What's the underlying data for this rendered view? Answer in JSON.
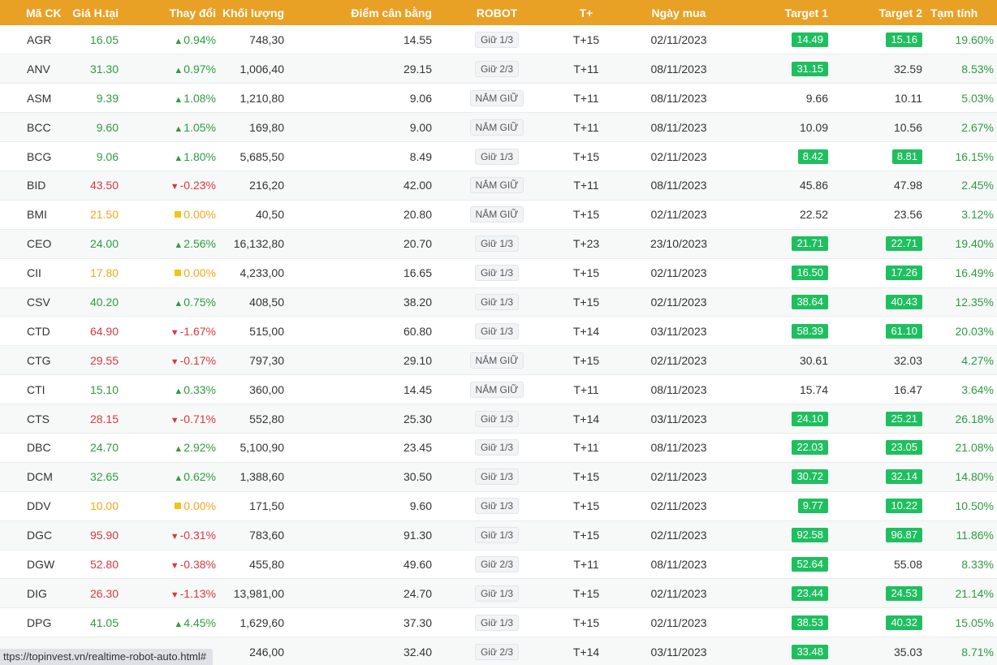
{
  "header": {
    "symbol": "Mã CK",
    "price": "Giá H.tại",
    "change": "Thay đổi",
    "volume": "Khối lượng",
    "balance": "Điểm cân bằng",
    "robot": "ROBOT",
    "tplus": "T+",
    "buy_date": "Ngày mua",
    "target1": "Target 1",
    "target2": "Target 2",
    "temp": "Tạm tính"
  },
  "rows": [
    {
      "symbol": "AGR",
      "price": "16.05",
      "trend": "up",
      "change": "0.94%",
      "volume": "748,30",
      "balance": "14.55",
      "robot": "Giữ 1/3",
      "tplus": "T+15",
      "buy_date": "02/11/2023",
      "target1": "14.49",
      "t1_hit": true,
      "target2": "15.16",
      "t2_hit": true,
      "temp": "19.60%"
    },
    {
      "symbol": "ANV",
      "price": "31.30",
      "trend": "up",
      "change": "0.97%",
      "volume": "1,006,40",
      "balance": "29.15",
      "robot": "Giữ 2/3",
      "tplus": "T+11",
      "buy_date": "08/11/2023",
      "target1": "31.15",
      "t1_hit": true,
      "target2": "32.59",
      "t2_hit": false,
      "temp": "8.53%"
    },
    {
      "symbol": "ASM",
      "price": "9.39",
      "trend": "up",
      "change": "1.08%",
      "volume": "1,210,80",
      "balance": "9.06",
      "robot": "NẮM GIỮ",
      "tplus": "T+11",
      "buy_date": "08/11/2023",
      "target1": "9.66",
      "t1_hit": false,
      "target2": "10.11",
      "t2_hit": false,
      "temp": "5.03%"
    },
    {
      "symbol": "BCC",
      "price": "9.60",
      "trend": "up",
      "change": "1.05%",
      "volume": "169,80",
      "balance": "9.00",
      "robot": "NẮM GIỮ",
      "tplus": "T+11",
      "buy_date": "08/11/2023",
      "target1": "10.09",
      "t1_hit": false,
      "target2": "10.56",
      "t2_hit": false,
      "temp": "2.67%"
    },
    {
      "symbol": "BCG",
      "price": "9.06",
      "trend": "up",
      "change": "1.80%",
      "volume": "5,685,50",
      "balance": "8.49",
      "robot": "Giữ 1/3",
      "tplus": "T+15",
      "buy_date": "02/11/2023",
      "target1": "8.42",
      "t1_hit": true,
      "target2": "8.81",
      "t2_hit": true,
      "temp": "16.15%"
    },
    {
      "symbol": "BID",
      "price": "43.50",
      "trend": "down",
      "change": "-0.23%",
      "volume": "216,20",
      "balance": "42.00",
      "robot": "NẮM GIỮ",
      "tplus": "T+11",
      "buy_date": "08/11/2023",
      "target1": "45.86",
      "t1_hit": false,
      "target2": "47.98",
      "t2_hit": false,
      "temp": "2.45%"
    },
    {
      "symbol": "BMI",
      "price": "21.50",
      "trend": "ref",
      "change": "0.00%",
      "volume": "40,50",
      "balance": "20.80",
      "robot": "NẮM GIỮ",
      "tplus": "T+15",
      "buy_date": "02/11/2023",
      "target1": "22.52",
      "t1_hit": false,
      "target2": "23.56",
      "t2_hit": false,
      "temp": "3.12%"
    },
    {
      "symbol": "CEO",
      "price": "24.00",
      "trend": "up",
      "change": "2.56%",
      "volume": "16,132,80",
      "balance": "20.70",
      "robot": "Giữ 1/3",
      "tplus": "T+23",
      "buy_date": "23/10/2023",
      "target1": "21.71",
      "t1_hit": true,
      "target2": "22.71",
      "t2_hit": true,
      "temp": "19.40%"
    },
    {
      "symbol": "CII",
      "price": "17.80",
      "trend": "ref",
      "change": "0.00%",
      "volume": "4,233,00",
      "balance": "16.65",
      "robot": "Giữ 1/3",
      "tplus": "T+15",
      "buy_date": "02/11/2023",
      "target1": "16.50",
      "t1_hit": true,
      "target2": "17.26",
      "t2_hit": true,
      "temp": "16.49%"
    },
    {
      "symbol": "CSV",
      "price": "40.20",
      "trend": "up",
      "change": "0.75%",
      "volume": "408,50",
      "balance": "38.20",
      "robot": "Giữ 1/3",
      "tplus": "T+15",
      "buy_date": "02/11/2023",
      "target1": "38.64",
      "t1_hit": true,
      "target2": "40.43",
      "t2_hit": true,
      "temp": "12.35%"
    },
    {
      "symbol": "CTD",
      "price": "64.90",
      "trend": "down",
      "change": "-1.67%",
      "volume": "515,00",
      "balance": "60.80",
      "robot": "Giữ 1/3",
      "tplus": "T+14",
      "buy_date": "03/11/2023",
      "target1": "58.39",
      "t1_hit": true,
      "target2": "61.10",
      "t2_hit": true,
      "temp": "20.03%"
    },
    {
      "symbol": "CTG",
      "price": "29.55",
      "trend": "down",
      "change": "-0.17%",
      "volume": "797,30",
      "balance": "29.10",
      "robot": "NẮM GIỮ",
      "tplus": "T+15",
      "buy_date": "02/11/2023",
      "target1": "30.61",
      "t1_hit": false,
      "target2": "32.03",
      "t2_hit": false,
      "temp": "4.27%"
    },
    {
      "symbol": "CTI",
      "price": "15.10",
      "trend": "up",
      "change": "0.33%",
      "volume": "360,00",
      "balance": "14.45",
      "robot": "NẮM GIỮ",
      "tplus": "T+11",
      "buy_date": "08/11/2023",
      "target1": "15.74",
      "t1_hit": false,
      "target2": "16.47",
      "t2_hit": false,
      "temp": "3.64%"
    },
    {
      "symbol": "CTS",
      "price": "28.15",
      "trend": "down",
      "change": "-0.71%",
      "volume": "552,80",
      "balance": "25.30",
      "robot": "Giữ 1/3",
      "tplus": "T+14",
      "buy_date": "03/11/2023",
      "target1": "24.10",
      "t1_hit": true,
      "target2": "25.21",
      "t2_hit": true,
      "temp": "26.18%"
    },
    {
      "symbol": "DBC",
      "price": "24.70",
      "trend": "up",
      "change": "2.92%",
      "volume": "5,100,90",
      "balance": "23.45",
      "robot": "Giữ 1/3",
      "tplus": "T+11",
      "buy_date": "08/11/2023",
      "target1": "22.03",
      "t1_hit": true,
      "target2": "23.05",
      "t2_hit": true,
      "temp": "21.08%"
    },
    {
      "symbol": "DCM",
      "price": "32.65",
      "trend": "up",
      "change": "0.62%",
      "volume": "1,388,60",
      "balance": "30.50",
      "robot": "Giữ 1/3",
      "tplus": "T+15",
      "buy_date": "02/11/2023",
      "target1": "30.72",
      "t1_hit": true,
      "target2": "32.14",
      "t2_hit": true,
      "temp": "14.80%"
    },
    {
      "symbol": "DDV",
      "price": "10.00",
      "trend": "ref",
      "change": "0.00%",
      "volume": "171,50",
      "balance": "9.60",
      "robot": "Giữ 1/3",
      "tplus": "T+15",
      "buy_date": "02/11/2023",
      "target1": "9.77",
      "t1_hit": true,
      "target2": "10.22",
      "t2_hit": true,
      "temp": "10.50%"
    },
    {
      "symbol": "DGC",
      "price": "95.90",
      "trend": "down",
      "change": "-0.31%",
      "volume": "783,60",
      "balance": "91.30",
      "robot": "Giữ 1/3",
      "tplus": "T+15",
      "buy_date": "02/11/2023",
      "target1": "92.58",
      "t1_hit": true,
      "target2": "96.87",
      "t2_hit": true,
      "temp": "11.86%"
    },
    {
      "symbol": "DGW",
      "price": "52.80",
      "trend": "down",
      "change": "-0.38%",
      "volume": "455,80",
      "balance": "49.60",
      "robot": "Giữ 2/3",
      "tplus": "T+11",
      "buy_date": "08/11/2023",
      "target1": "52.64",
      "t1_hit": true,
      "target2": "55.08",
      "t2_hit": false,
      "temp": "8.33%"
    },
    {
      "symbol": "DIG",
      "price": "26.30",
      "trend": "down",
      "change": "-1.13%",
      "volume": "13,981,00",
      "balance": "24.70",
      "robot": "Giữ 1/3",
      "tplus": "T+15",
      "buy_date": "02/11/2023",
      "target1": "23.44",
      "t1_hit": true,
      "target2": "24.53",
      "t2_hit": true,
      "temp": "21.14%"
    },
    {
      "symbol": "DPG",
      "price": "41.05",
      "trend": "up",
      "change": "4.45%",
      "volume": "1,629,60",
      "balance": "37.30",
      "robot": "Giữ 1/3",
      "tplus": "T+15",
      "buy_date": "02/11/2023",
      "target1": "38.53",
      "t1_hit": true,
      "target2": "40.32",
      "t2_hit": true,
      "temp": "15.05%"
    },
    {
      "symbol": "",
      "price": "",
      "trend": "none",
      "change": "",
      "volume": "246,00",
      "balance": "32.40",
      "robot": "Giữ 2/3",
      "tplus": "T+14",
      "buy_date": "03/11/2023",
      "target1": "33.48",
      "t1_hit": true,
      "target2": "35.03",
      "t2_hit": false,
      "temp": "8.71%"
    }
  ],
  "status_bar": {
    "url": "ttps://topinvest.vn/realtime-robot-auto.html#"
  },
  "colors": {
    "header_bg": "#e8a125",
    "up": "#2e9b3f",
    "down": "#d9383e",
    "ref": "#f0a81c",
    "target_badge": "#1fbf5f"
  }
}
